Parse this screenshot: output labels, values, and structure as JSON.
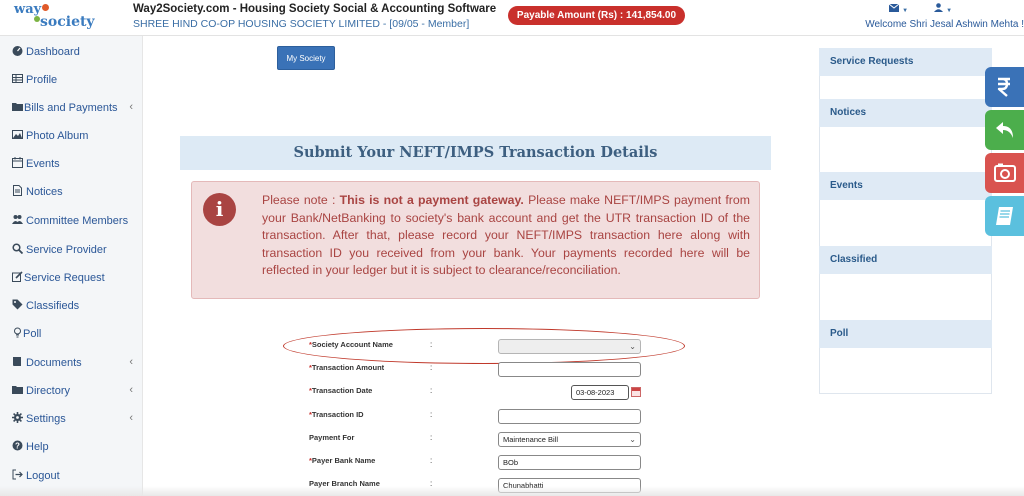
{
  "header": {
    "logo_top": "way",
    "logo_bottom": "society",
    "title": "Way2Society.com - Housing Society Social & Accounting Software",
    "subtitle": "SHREE HIND CO-OP HOUSING SOCIETY LIMITED - [09/05 - Member]",
    "payable": "Payable Amount (Rs) : 141,854.00",
    "mail_icon": "▼",
    "user_icon": "▼",
    "welcome": "Welcome Shri Jesal Ashwin Mehta !"
  },
  "sidebar": {
    "items": [
      {
        "label": "Dashboard",
        "icon": "dashboard-icon",
        "chevron": ""
      },
      {
        "label": "Profile",
        "icon": "table-icon",
        "chevron": ""
      },
      {
        "label": "Bills and Payments",
        "icon": "folder-icon",
        "chevron": "‹"
      },
      {
        "label": "Photo Album",
        "icon": "image-icon",
        "chevron": ""
      },
      {
        "label": "Events",
        "icon": "calendar-icon",
        "chevron": ""
      },
      {
        "label": "Notices",
        "icon": "file-icon",
        "chevron": ""
      },
      {
        "label": "Committee Members",
        "icon": "users-icon",
        "chevron": ""
      },
      {
        "label": "Service Provider",
        "icon": "search-icon",
        "chevron": ""
      },
      {
        "label": "Service Request",
        "icon": "edit-icon",
        "chevron": ""
      },
      {
        "label": "Classifieds",
        "icon": "tag-icon",
        "chevron": ""
      },
      {
        "label": "Poll",
        "icon": "lightbulb-icon",
        "chevron": ""
      },
      {
        "label": "Documents",
        "icon": "book-icon",
        "chevron": "‹"
      },
      {
        "label": "Directory",
        "icon": "folder-icon",
        "chevron": "‹"
      },
      {
        "label": "Settings",
        "icon": "gear-icon",
        "chevron": "‹"
      },
      {
        "label": "Help",
        "icon": "help-icon",
        "chevron": ""
      },
      {
        "label": "Logout",
        "icon": "logout-icon",
        "chevron": ""
      }
    ]
  },
  "main": {
    "my_society_button": "My Society",
    "panel_title": "Submit Your NEFT/IMPS Transaction Details",
    "note_icon": "i",
    "note_prefix": "Please note : ",
    "note_bold": "This is not a payment gateway.",
    "note_rest": " Please make NEFT/IMPS payment from your Bank/NetBanking to society's bank account and get the UTR transaction ID of the transaction. After that, please record your NEFT/IMPS transaction here along with transaction ID you received from your bank. Your payments recorded here will be reflected in your ledger but it is subject to clearance/reconciliation.",
    "form": {
      "required_mark": "*",
      "colon": ":",
      "fields": [
        {
          "label": "Society Account Name",
          "required": true,
          "type": "select",
          "value": ""
        },
        {
          "label": "Transaction Amount",
          "required": true,
          "type": "text",
          "value": ""
        },
        {
          "label": "Transaction Date",
          "required": true,
          "type": "date",
          "value": "03-08-2023"
        },
        {
          "label": "Transaction ID",
          "required": true,
          "type": "text",
          "value": ""
        },
        {
          "label": "Payment For",
          "required": false,
          "type": "select",
          "value": "Maintenance Bill"
        },
        {
          "label": "Payer Bank Name",
          "required": true,
          "type": "text",
          "value": "BOb"
        },
        {
          "label": "Payer Branch Name",
          "required": false,
          "type": "text",
          "value": "Chunabhatti"
        }
      ]
    }
  },
  "right_column": {
    "sections": [
      "Service Requests",
      "Notices",
      "Events",
      "Classified",
      "Poll"
    ]
  },
  "floating_buttons": [
    {
      "name": "rupee-icon",
      "color": "#3a72b7"
    },
    {
      "name": "reply-icon",
      "color": "#4cae4c"
    },
    {
      "name": "camera-icon",
      "color": "#d9534f"
    },
    {
      "name": "book-icon",
      "color": "#5bc0de"
    }
  ],
  "colors": {
    "accent": "#3a72b7",
    "danger": "#c9302c",
    "note_text": "#a94442",
    "panel_header": "#ddeaf5"
  }
}
